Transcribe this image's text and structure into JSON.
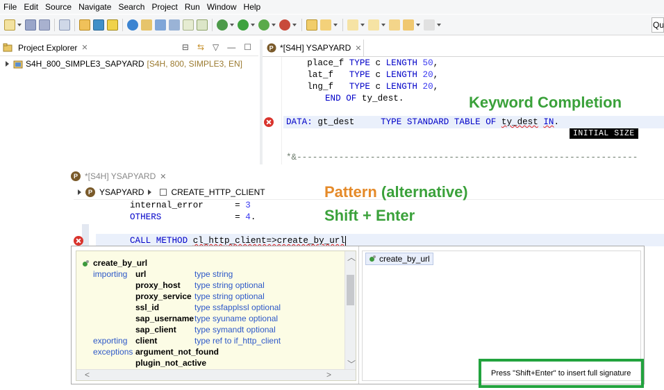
{
  "menu": [
    "File",
    "Edit",
    "Source",
    "Navigate",
    "Search",
    "Project",
    "Run",
    "Window",
    "Help"
  ],
  "search_box": {
    "value": "Qu"
  },
  "project_explorer": {
    "title": "Project Explorer",
    "tree": [
      {
        "name": "S4H_800_SIMPLE3_SAPYARD",
        "detail": "[S4H, 800, SIMPLE3, EN]"
      }
    ]
  },
  "top_editor": {
    "tab_label": "*[S4H] YSAPYARD",
    "lines": [
      {
        "indent": "    ",
        "field": "place_f",
        "kw1": "TYPE",
        "type": "c",
        "kw2": "LENGTH",
        "num": "50",
        "end": ","
      },
      {
        "indent": "    ",
        "field": "lat_f  ",
        "kw1": "TYPE",
        "type": "c",
        "kw2": "LENGTH",
        "num": "20",
        "end": ","
      },
      {
        "indent": "    ",
        "field": "lng_f  ",
        "kw1": "TYPE",
        "type": "c",
        "kw2": "LENGTH",
        "num": "20",
        "end": ","
      }
    ],
    "end_line": {
      "kw": "END OF",
      "name": "ty_dest."
    },
    "data_line": {
      "kw": "DATA:",
      "var": "gt_dest",
      "kw2": "TYPE STANDARD TABLE OF",
      "type": "ty_dest",
      "partial": "IN",
      "dot": "."
    },
    "completion_tooltip": "INITIAL SIZE",
    "comment_line": "*&-----------------------------------------------------------------"
  },
  "captions": {
    "keyword_completion": "Keyword Completion",
    "pattern": "Pattern",
    "alternative": "(alternative)",
    "shortcut": "Shift + Enter"
  },
  "bottom_editor": {
    "tab_label": "*[S4H] YSAPYARD",
    "breadcrumb": {
      "program": "YSAPYARD",
      "method": "CREATE_HTTP_CLIENT"
    },
    "lines": [
      {
        "name": "internal_error",
        "op": "=",
        "value": "3",
        "end": ""
      },
      {
        "name": "OTHERS",
        "op": "=",
        "value": "4",
        "end": "."
      }
    ],
    "call_line": {
      "kw": "CALL METHOD",
      "text": "cl_http_client=>create_by_url"
    }
  },
  "content_assist": {
    "signature_title": "create_by_url",
    "rows": [
      {
        "kind": "importing",
        "param": "url",
        "type": "type string",
        "optional": ""
      },
      {
        "kind": "",
        "param": "proxy_host",
        "type": "type string",
        "optional": "optional"
      },
      {
        "kind": "",
        "param": "proxy_service",
        "type": "type string",
        "optional": "optional"
      },
      {
        "kind": "",
        "param": "ssl_id",
        "type": "type ssfapplssl",
        "optional": "optional"
      },
      {
        "kind": "",
        "param": "sap_username",
        "type": "type syuname",
        "optional": "optional"
      },
      {
        "kind": "",
        "param": "sap_client",
        "type": "type symandt",
        "optional": "optional"
      },
      {
        "kind": "exporting",
        "param": "client",
        "type": "type ref to if_http_client",
        "optional": ""
      },
      {
        "kind": "exceptions",
        "param": "argument_not_found",
        "type": "",
        "optional": ""
      },
      {
        "kind": "",
        "param": "plugin_not_active",
        "type": "",
        "optional": ""
      }
    ],
    "proposal": "create_by_url",
    "hint": "Press \"Shift+Enter\" to insert full signature"
  },
  "colors": {
    "keyword": "#0000c8",
    "caption_green": "#3aa13a",
    "caption_orange": "#e58a29",
    "highlight_box": "#22a33e",
    "error": "#d9332c"
  }
}
